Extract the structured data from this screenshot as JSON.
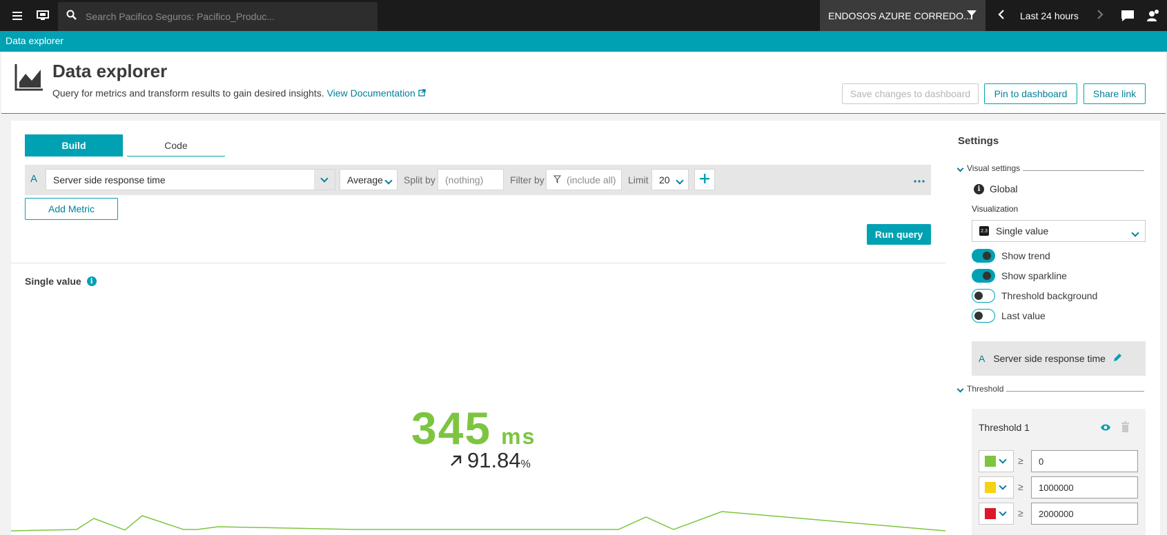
{
  "topbar": {
    "search_placeholder": "Search Pacifico Seguros: Pacifico_Produc...",
    "management_zone": "ENDOSOS AZURE CORREDO...",
    "timeframe": "Last 24 hours"
  },
  "breadcrumb": {
    "label": "Data explorer"
  },
  "header": {
    "title": "Data explorer",
    "description": "Query for metrics and transform results to gain desired insights.",
    "doc_link": "View Documentation",
    "save_label": "Save changes to dashboard",
    "pin_label": "Pin to dashboard",
    "share_label": "Share link"
  },
  "tabs": [
    {
      "label": "Build"
    },
    {
      "label": "Code"
    }
  ],
  "query": {
    "letter": "A",
    "metric": "Server side response time",
    "aggregation": "Average",
    "split_label": "Split by",
    "split_value": "(nothing)",
    "filter_label": "Filter by",
    "filter_value": "(include all)",
    "limit_label": "Limit",
    "limit_value": "20",
    "add_metric": "Add Metric",
    "run_query": "Run query"
  },
  "result": {
    "title": "Single value",
    "value": "345",
    "unit": "ms",
    "trend_value": "91.84",
    "trend_unit": "%"
  },
  "settings": {
    "title": "Settings",
    "visual_settings": "Visual settings",
    "global": "Global",
    "visualization_label": "Visualization",
    "visualization_value": "Single value",
    "toggles": [
      {
        "label": "Show trend",
        "on": true
      },
      {
        "label": "Show sparkline",
        "on": true
      },
      {
        "label": "Threshold background",
        "on": false
      },
      {
        "label": "Last value",
        "on": false
      }
    ],
    "metric_card": {
      "letter": "A",
      "label": "Server side response time"
    },
    "threshold_head": "Threshold",
    "threshold_title": "Threshold 1",
    "thresholds": [
      {
        "color": "#7dc540",
        "value": "0"
      },
      {
        "color": "#f5d30f",
        "value": "1000000"
      },
      {
        "color": "#dc172a",
        "value": "2000000"
      }
    ]
  },
  "colors": {
    "accent": "#00a1b2",
    "good": "#7dc540"
  },
  "sparkline": {
    "values": [
      0.15,
      0.2,
      0.6,
      0.18,
      0.7,
      0.2,
      0.2,
      0.3,
      0.2,
      0.2,
      0.65,
      0.2,
      0.85,
      0.15
    ]
  }
}
